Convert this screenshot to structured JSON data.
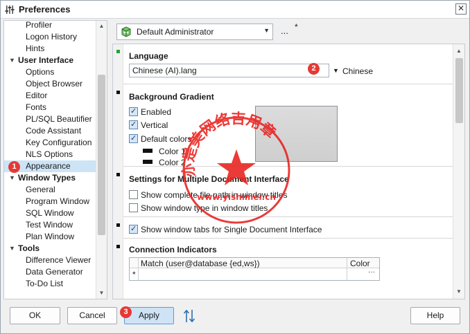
{
  "window": {
    "title": "Preferences",
    "close_glyph": "✕"
  },
  "tree": {
    "items": [
      {
        "label": "Profiler",
        "type": "child"
      },
      {
        "label": "Logon History",
        "type": "child"
      },
      {
        "label": "Hints",
        "type": "child"
      },
      {
        "label": "User Interface",
        "type": "group"
      },
      {
        "label": "Options",
        "type": "child"
      },
      {
        "label": "Object Browser",
        "type": "child"
      },
      {
        "label": "Editor",
        "type": "child"
      },
      {
        "label": "Fonts",
        "type": "child"
      },
      {
        "label": "PL/SQL Beautifier",
        "type": "child"
      },
      {
        "label": "Code Assistant",
        "type": "child"
      },
      {
        "label": "Key Configuration",
        "type": "child"
      },
      {
        "label": "NLS Options",
        "type": "child"
      },
      {
        "label": "Appearance",
        "type": "child",
        "selected": true
      },
      {
        "label": "Window Types",
        "type": "group"
      },
      {
        "label": "General",
        "type": "child"
      },
      {
        "label": "Program Window",
        "type": "child"
      },
      {
        "label": "SQL Window",
        "type": "child"
      },
      {
        "label": "Test Window",
        "type": "child"
      },
      {
        "label": "Plan Window",
        "type": "child"
      },
      {
        "label": "Tools",
        "type": "group"
      },
      {
        "label": "Difference Viewer",
        "type": "child"
      },
      {
        "label": "Data Generator",
        "type": "child"
      },
      {
        "label": "To-Do List",
        "type": "child"
      }
    ]
  },
  "badges": {
    "one": "1",
    "two": "2",
    "three": "3"
  },
  "user_bar": {
    "selected": "Default Administrator",
    "ellipsis": "...",
    "modified_marker": "*"
  },
  "language": {
    "title": "Language",
    "file": "Chinese (AI).lang",
    "name": "Chinese"
  },
  "gradient": {
    "title": "Background Gradient",
    "enabled": "Enabled",
    "vertical": "Vertical",
    "default_colors": "Default colors",
    "color1": "Color 1",
    "color2": "Color 2"
  },
  "mdi": {
    "title": "Settings for Multiple Document Interface",
    "show_path": "Show complete file path in window titles",
    "show_type": "Show window type in window titles"
  },
  "sdi": {
    "show_tabs": "Show window tabs for Single Document Interface"
  },
  "connection": {
    "title": "Connection Indicators",
    "col_match": "Match (user@database {ed,ws})",
    "col_color": "Color",
    "new_row_marker": "*",
    "dots": "···"
  },
  "buttons": {
    "ok": "OK",
    "cancel": "Cancel",
    "apply": "Apply",
    "help": "Help"
  },
  "watermark": {
    "text": "亦是美网络吉用章",
    "url": "www.yishimei.cn"
  },
  "colors": {
    "accent": "#cde4f7",
    "badge": "#e53935",
    "stamp": "#e8211d"
  }
}
